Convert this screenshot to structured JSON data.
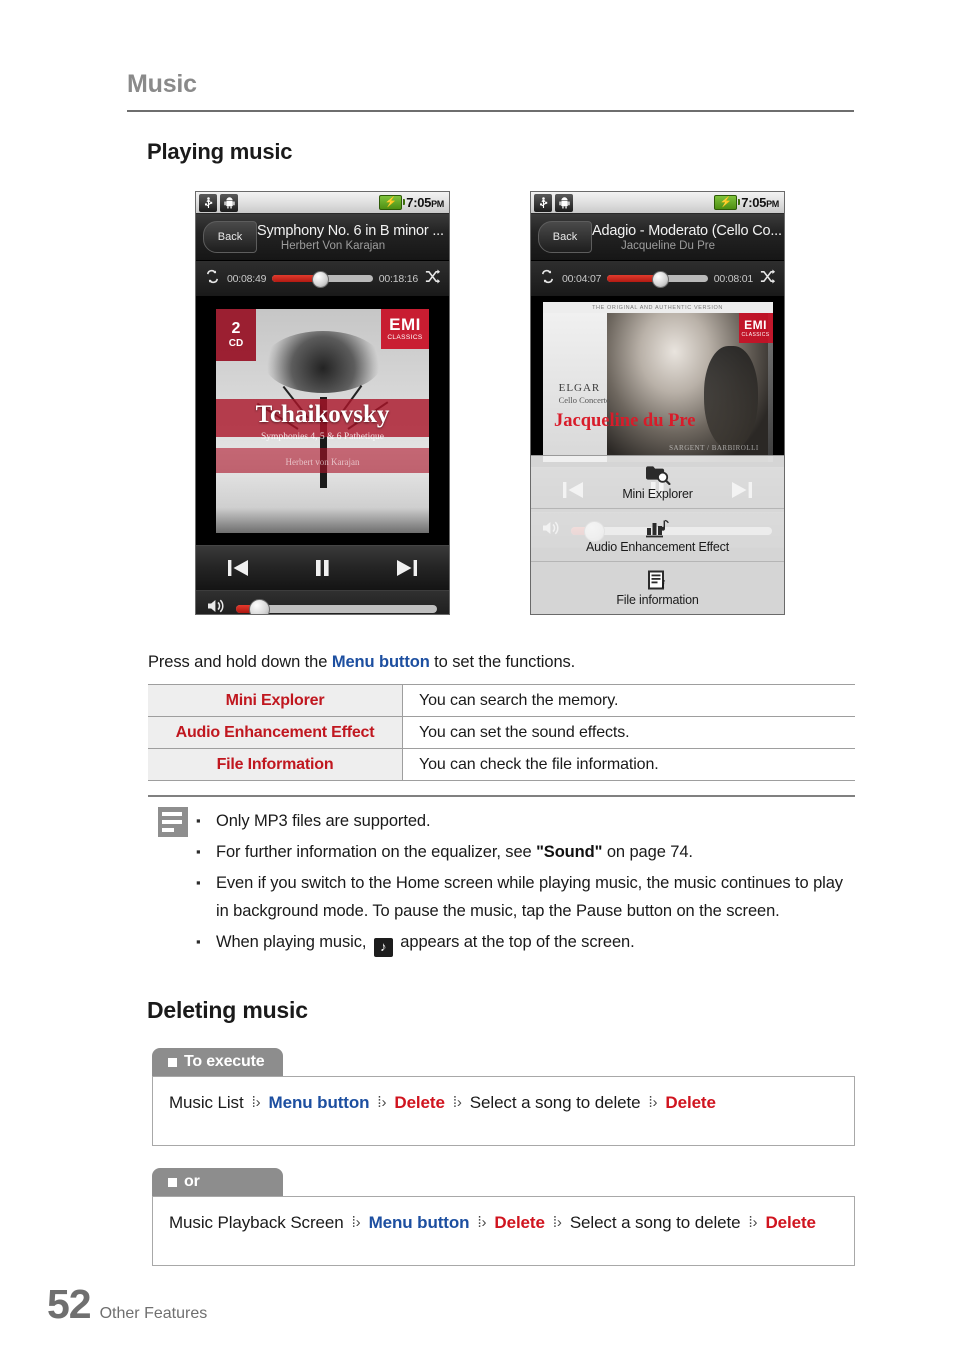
{
  "running_head": "Music",
  "sections": {
    "playing": "Playing music",
    "deleting": "Deleting music"
  },
  "phones": [
    {
      "status": {
        "usb_icon": "usb-icon",
        "android_icon": "android-robot-icon",
        "battery_icon": "battery-charging-icon",
        "time": "7:05",
        "ampm": "PM"
      },
      "back_label": "Back",
      "track_title": "Symphony No. 6 in B minor ...",
      "artist": "Herbert Von Karajan",
      "elapsed": "00:08:49",
      "duration": "00:18:16",
      "repeat_icon": "repeat-icon",
      "shuffle_icon": "shuffle-icon",
      "seek_percent": 47,
      "volume_percent": 11,
      "album": {
        "badge_number": "2",
        "badge_label": "CD",
        "logo": "EMI",
        "logo_sub": "CLASSICS",
        "title": "Tchaikovsky",
        "subtitle": "Symphonies 4, 5 & 6 Pathetique",
        "performer": "Herbert von Karajan"
      },
      "transport": {
        "previous": "previous-track-icon",
        "playpause": "pause-icon",
        "next": "next-track-icon",
        "volume": "volume-icon"
      }
    },
    {
      "status": {
        "usb_icon": "usb-icon",
        "android_icon": "android-robot-icon",
        "battery_icon": "battery-charging-icon",
        "time": "7:05",
        "ampm": "PM"
      },
      "back_label": "Back",
      "track_title": "Adagio - Moderato (Cello Co...",
      "artist": "Jacqueline Du Pre",
      "elapsed": "00:04:07",
      "duration": "00:08:01",
      "repeat_icon": "repeat-icon",
      "shuffle_icon": "shuffle-icon",
      "seek_percent": 51,
      "volume_percent": 11,
      "album": {
        "top_strip": "THE ORIGINAL AND AUTHENTIC VERSION",
        "logo": "EMI",
        "logo_sub": "CLASSICS",
        "composer": "ELGAR",
        "work": "Cello Concerto",
        "artist_name": "Jacqueline du Pre",
        "conductor": "SARGENT / BARBIROLLI"
      },
      "transport": {
        "previous": "previous-track-icon",
        "playpause": "pause-icon",
        "next": "next-track-icon",
        "volume": "volume-icon"
      },
      "context_menu": [
        {
          "icon": "folder-search-icon",
          "label": "Mini Explorer"
        },
        {
          "icon": "equalizer-icon",
          "label": "Audio Enhancement Effect"
        },
        {
          "icon": "file-info-icon",
          "label": "File information"
        }
      ]
    }
  ],
  "intro": {
    "before": "Press and hold down the ",
    "keyword": "Menu button",
    "after": " to set the functions."
  },
  "functions_table": [
    {
      "name": "Mini Explorer",
      "desc": "You can search the memory."
    },
    {
      "name": "Audio Enhancement Effect",
      "desc": "You can set the sound effects."
    },
    {
      "name": "File Information",
      "desc": "You can check the file information."
    }
  ],
  "notes": {
    "icon": "note-icon",
    "items": [
      {
        "type": "plain",
        "text": "Only MP3 files are supported."
      },
      {
        "type": "sound_ref",
        "before": "For further information on the equalizer, see ",
        "bold": "\"Sound\"",
        "after": " on page 74."
      },
      {
        "type": "plain",
        "text": "Even if you switch to the Home screen while playing music, the music continues to play in background mode. To pause the music, tap the Pause button on the screen."
      },
      {
        "type": "music_icon",
        "before": "When playing music, ",
        "icon": "music-note-icon",
        "after": " appears at the top of the screen."
      }
    ]
  },
  "procedures": [
    {
      "tab": "To execute",
      "steps": [
        {
          "text": "Music List",
          "style": "plain"
        },
        {
          "text": "Menu button",
          "style": "blue"
        },
        {
          "text": "Delete",
          "style": "red"
        },
        {
          "text": "Select a song to delete",
          "style": "plain"
        },
        {
          "text": "Delete",
          "style": "red"
        }
      ]
    },
    {
      "tab": "or",
      "steps": [
        {
          "text": "Music Playback Screen",
          "style": "plain"
        },
        {
          "text": "Menu button",
          "style": "blue"
        },
        {
          "text": "Delete",
          "style": "red"
        },
        {
          "text": "Select a song to delete",
          "style": "plain"
        },
        {
          "text": "Delete",
          "style": "red"
        }
      ]
    }
  ],
  "footer": {
    "page": "52",
    "section": "Other Features"
  },
  "colors": {
    "keyword_blue": "#1d4fa0",
    "keyword_red": "#d0141f",
    "table_name_red": "#c0171f",
    "heading_gray": "#8a8a8a",
    "tab_gray": "#8d8d8d"
  }
}
